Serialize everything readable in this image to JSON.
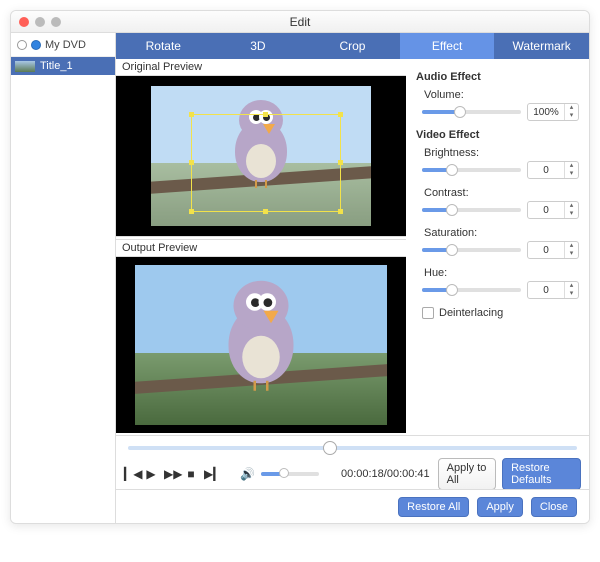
{
  "window": {
    "title": "Edit"
  },
  "sidebar": {
    "dvd_label": "My DVD",
    "items": [
      {
        "label": "Title_1"
      }
    ]
  },
  "tabs": [
    "Rotate",
    "3D",
    "Crop",
    "Effect",
    "Watermark"
  ],
  "active_tab": 3,
  "previews": {
    "original": "Original Preview",
    "output": "Output Preview"
  },
  "panel": {
    "audio_header": "Audio Effect",
    "video_header": "Video Effect",
    "volume": {
      "label": "Volume:",
      "value": "100%",
      "pct": 38
    },
    "brightness": {
      "label": "Brightness:",
      "value": "0",
      "pct": 30
    },
    "contrast": {
      "label": "Contrast:",
      "value": "0",
      "pct": 30
    },
    "saturation": {
      "label": "Saturation:",
      "value": "0",
      "pct": 30
    },
    "hue": {
      "label": "Hue:",
      "value": "0",
      "pct": 30
    },
    "deinterlacing": "Deinterlacing"
  },
  "player": {
    "position_pct": 45,
    "time": "00:00:18/00:00:41",
    "apply_all": "Apply to All",
    "restore_defaults": "Restore Defaults"
  },
  "footer": {
    "restore_all": "Restore All",
    "apply": "Apply",
    "close": "Close"
  }
}
